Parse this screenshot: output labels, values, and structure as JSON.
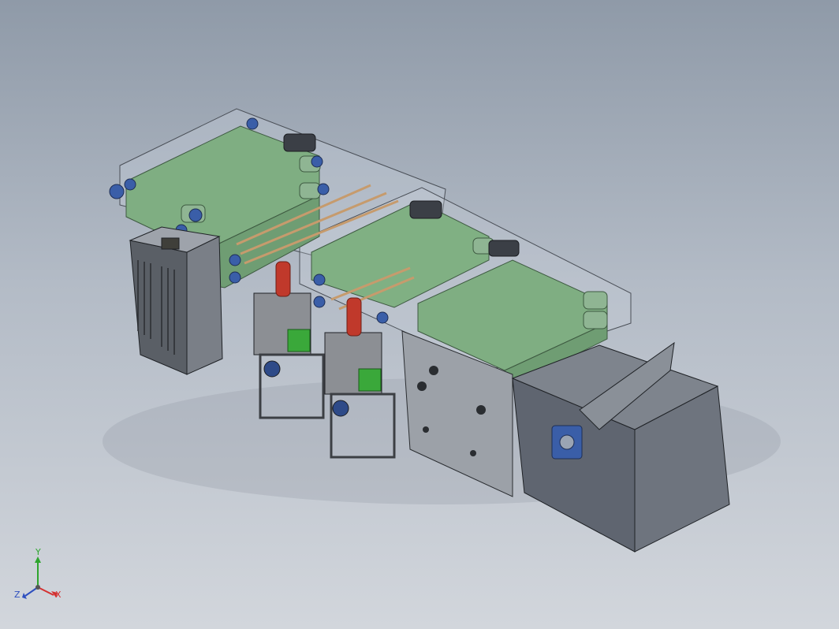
{
  "viewport": {
    "background_top": "#8f9aa8",
    "background_bottom": "#d2d6dc"
  },
  "colors": {
    "belt": "#7fae82",
    "frame": "#5d636b",
    "hopper": "#5f6570",
    "bearing": "#3a5ea8",
    "red_part": "#c0392b",
    "green_part": "#3aa83a"
  },
  "triad": {
    "y_label": "Y",
    "z_label": "Z",
    "x_label": "X",
    "y_color": "#2ea52e",
    "z_color": "#2e4fbf",
    "x_color": "#d43030"
  }
}
